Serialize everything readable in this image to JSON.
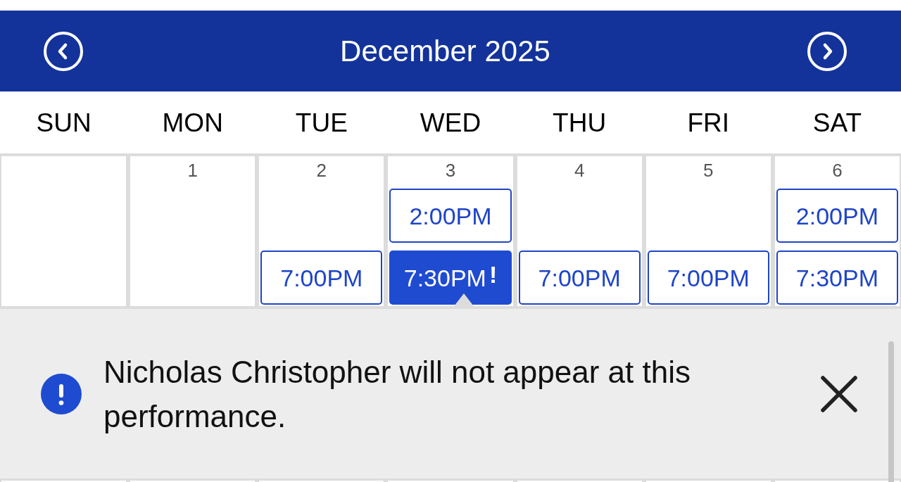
{
  "header": {
    "title": "December 2025"
  },
  "weekdays": [
    "SUN",
    "MON",
    "TUE",
    "WED",
    "THU",
    "FRI",
    "SAT"
  ],
  "days": [
    {
      "kind": "blank"
    },
    {
      "kind": "day",
      "date": "1"
    },
    {
      "kind": "day",
      "date": "2",
      "evening": {
        "time": "7:00PM",
        "selected": false
      }
    },
    {
      "kind": "day",
      "date": "3",
      "matinee": {
        "time": "2:00PM",
        "selected": false
      },
      "evening": {
        "time": "7:30PM",
        "selected": true,
        "badge": "!"
      }
    },
    {
      "kind": "day",
      "date": "4",
      "evening": {
        "time": "7:00PM",
        "selected": false
      }
    },
    {
      "kind": "day",
      "date": "5",
      "evening": {
        "time": "7:00PM",
        "selected": false
      }
    },
    {
      "kind": "day",
      "date": "6",
      "matinee": {
        "time": "2:00PM",
        "selected": false
      },
      "evening": {
        "time": "7:30PM",
        "selected": false
      }
    }
  ],
  "notice": {
    "text": "Nicholas Christopher will not appear at this performance."
  }
}
